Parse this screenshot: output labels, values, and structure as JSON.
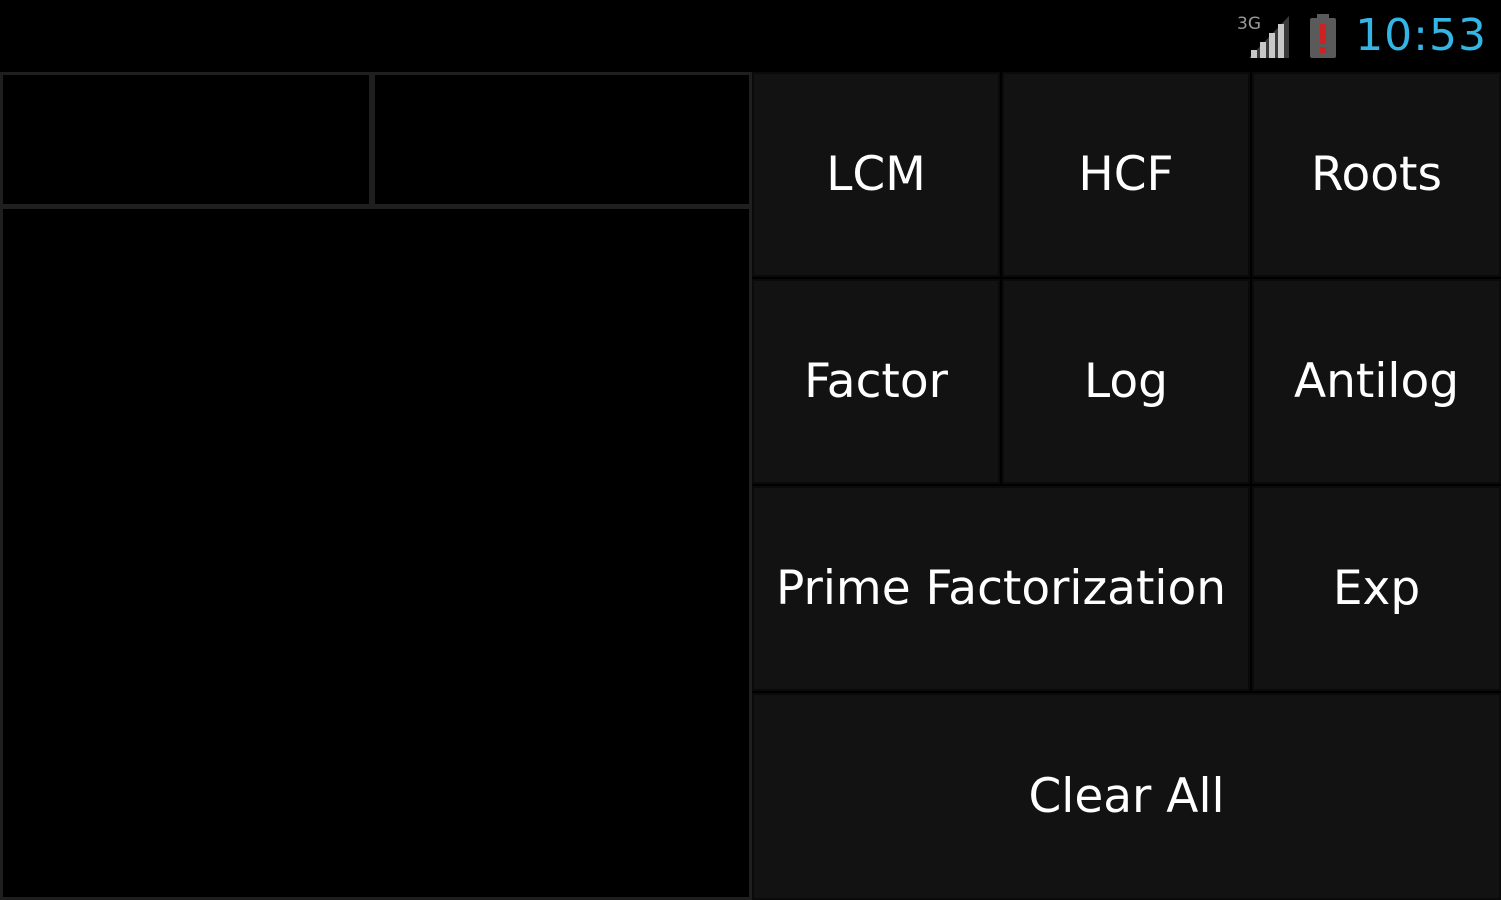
{
  "status_bar": {
    "network": "3G",
    "time": "10:53",
    "signal_icon": "signal-icon",
    "battery_icon": "battery-alert-icon",
    "clock_color": "#33b5e5",
    "battery_alert_color": "#cc2222"
  },
  "display": {
    "first_value": "",
    "second_value": "",
    "result": ""
  },
  "buttons": {
    "lcm": "LCM",
    "hcf": "HCF",
    "roots": "Roots",
    "factor": "Factor",
    "log": "Log",
    "antilog": "Antilog",
    "prime_factorization": "Prime Factorization",
    "exp": "Exp",
    "clear_all": "Clear All"
  },
  "colors": {
    "background": "#000000",
    "button_background": "#121212",
    "button_text": "#ffffff",
    "divider": "#1f1f1f"
  }
}
